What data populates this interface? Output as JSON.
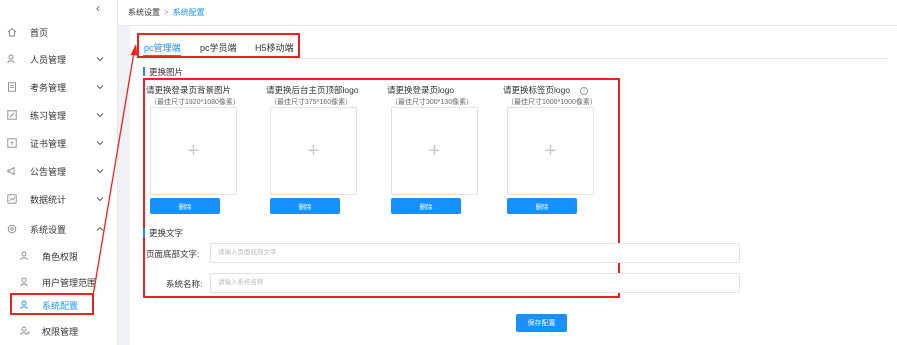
{
  "sidebar": {
    "collapse_icon": "chevron-left-icon",
    "items": [
      {
        "label": "首页",
        "icon": "home-icon",
        "has_chevron": false
      },
      {
        "label": "人员管理",
        "icon": "user-icon",
        "has_chevron": true
      },
      {
        "label": "考务管理",
        "icon": "document-icon",
        "has_chevron": true
      },
      {
        "label": "练习管理",
        "icon": "edit-icon",
        "has_chevron": true
      },
      {
        "label": "证书管理",
        "icon": "certificate-icon",
        "has_chevron": true
      },
      {
        "label": "公告管理",
        "icon": "notice-icon",
        "has_chevron": true
      },
      {
        "label": "数据统计",
        "icon": "chart-icon",
        "has_chevron": true
      },
      {
        "label": "系统设置",
        "icon": "settings-icon",
        "has_chevron": true,
        "expanded": true
      }
    ],
    "sub_items": [
      {
        "label": "角色权限",
        "icon": "user-role-icon"
      },
      {
        "label": "用户管理范围",
        "icon": "user-scope-icon"
      },
      {
        "label": "系统配置",
        "icon": "user-config-icon",
        "active": true
      },
      {
        "label": "权限管理",
        "icon": "permission-icon"
      }
    ]
  },
  "breadcrumb": {
    "parent": "系统设置",
    "separator": ">",
    "current": "系统配置"
  },
  "tabs": [
    {
      "label": "pc管理端",
      "active": true
    },
    {
      "label": "pc学员端",
      "active": false
    },
    {
      "label": "H5移动端",
      "active": false
    }
  ],
  "images_section": {
    "title": "更换图片",
    "uploads": [
      {
        "title": "请更换登录页背景图片",
        "hint": "（最佳尺寸1920*1080像素）",
        "delete_label": "删除"
      },
      {
        "title": "请更换后台主页顶部logo",
        "hint": "（最佳尺寸375*160像素）",
        "delete_label": "删除"
      },
      {
        "title": "请更换登录页logo",
        "hint": "（最佳尺寸300*130像素）",
        "delete_label": "删除"
      },
      {
        "title": "请更换标签页logo",
        "hint": "（最佳尺寸1000*1000像素）",
        "delete_label": "删除",
        "info_icon": "info-circle-icon"
      }
    ],
    "plus_glyph": "+"
  },
  "text_section": {
    "title": "更换文字",
    "footer_label": "页面底部文字:",
    "footer_placeholder": "请输入页面底部文字",
    "name_label": "系统名称:",
    "name_placeholder": "请输入系统名称"
  },
  "save_label": "保存配置",
  "colors": {
    "accent": "#1890ff",
    "highlight": "#e22222"
  }
}
